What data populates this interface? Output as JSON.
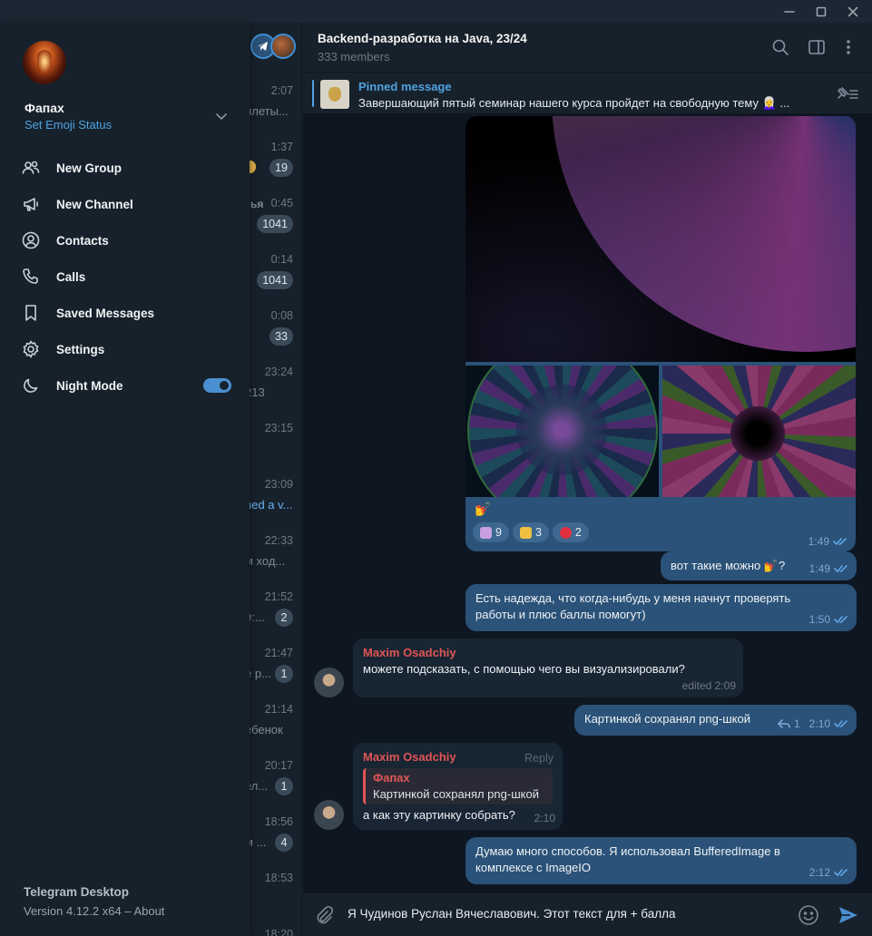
{
  "window": {
    "minimize_icon": "minimize-icon",
    "maximize_icon": "maximize-icon",
    "close_icon": "close-icon"
  },
  "drawer": {
    "user_name": "Фапах",
    "status_link": "Set Emoji Status",
    "menu": [
      {
        "label": "New Group",
        "icon": "people-icon"
      },
      {
        "label": "New Channel",
        "icon": "megaphone-icon"
      },
      {
        "label": "Contacts",
        "icon": "contact-icon"
      },
      {
        "label": "Calls",
        "icon": "phone-icon"
      },
      {
        "label": "Saved Messages",
        "icon": "bookmark-icon"
      },
      {
        "label": "Settings",
        "icon": "gear-icon"
      },
      {
        "label": "Night Mode",
        "icon": "moon-icon",
        "toggle_on": true
      }
    ],
    "app_name": "Telegram Desktop",
    "version": "Version 4.12.2 x64 – ",
    "about": "About"
  },
  "chatlist": {
    "rows": [
      {
        "time": "2:07",
        "preview": "илеты..."
      },
      {
        "time": "1:37",
        "preview": "",
        "badge": "19"
      },
      {
        "time": "0:45",
        "prefix": "ья",
        "preview": ".",
        "badge": "1041"
      },
      {
        "time": "0:14",
        "preview": "",
        "badge": "1041"
      },
      {
        "time": "0:08",
        "preview": "",
        "badge": "33"
      },
      {
        "time": "23:24",
        "preview": "213"
      },
      {
        "time": "23:15",
        "preview": ""
      },
      {
        "time": "23:09",
        "preview": "ned a v..."
      },
      {
        "time": "22:33",
        "preview": "м ход..."
      },
      {
        "time": "21:52",
        "preview": "9:...",
        "badge": "2"
      },
      {
        "time": "21:47",
        "preview": "е р...",
        "badge": "1"
      },
      {
        "time": "21:14",
        "preview": "ебенок"
      },
      {
        "time": "20:17",
        "preview": "ел...",
        "badge": "1"
      },
      {
        "time": "18:56",
        "preview": "м ...",
        "badge": "4"
      },
      {
        "time": "18:53",
        "preview": ""
      },
      {
        "time": "18:20",
        "preview": ""
      }
    ]
  },
  "chat": {
    "title": "Backend-разработка на Java, 23/24",
    "members": "333 members",
    "pinned_title": "Pinned message",
    "pinned_text": "Завершающий пятый семинар нашего курса пройдет на свободную тему 👩‍🦳 ...",
    "media_caption": "💅",
    "reactions": [
      {
        "emoji": "💅",
        "count": "9",
        "color": "#c8a0e0"
      },
      {
        "emoji": "👍",
        "count": "3",
        "color": "#f0c040"
      },
      {
        "emoji": "❤",
        "count": "2",
        "color": "#e03040"
      }
    ],
    "media_time": "1:49",
    "messages": [
      {
        "text": "вот такие можно 💅?",
        "time": "1:49"
      },
      {
        "text": "Есть надежда, что когда-нибудь у меня начнут проверять работы и плюс баллы помогут)",
        "time": "1:50"
      },
      {
        "sender": "Maxim Osadchiy",
        "text": "можете подсказать, с помощью чего вы визуализировали?",
        "time": "edited 2:09"
      },
      {
        "text": "Картинкой сохранял png-шкой",
        "time": "2:10",
        "replies": "1"
      },
      {
        "sender": "Maxim Osadchiy",
        "reply_label": "Reply",
        "quote_name": "Фапах",
        "quote_text": "Картинкой сохранял png-шкой",
        "text": "а как эту картинку собрать?",
        "time": "2:10"
      },
      {
        "text": "Думаю много способов. Я использовал BufferedImage в комплексе с ImageIO",
        "time": "2:12"
      }
    ],
    "composer_text": "Я Чудинов Руслан Вячеславович. Этот текст для + балла"
  }
}
